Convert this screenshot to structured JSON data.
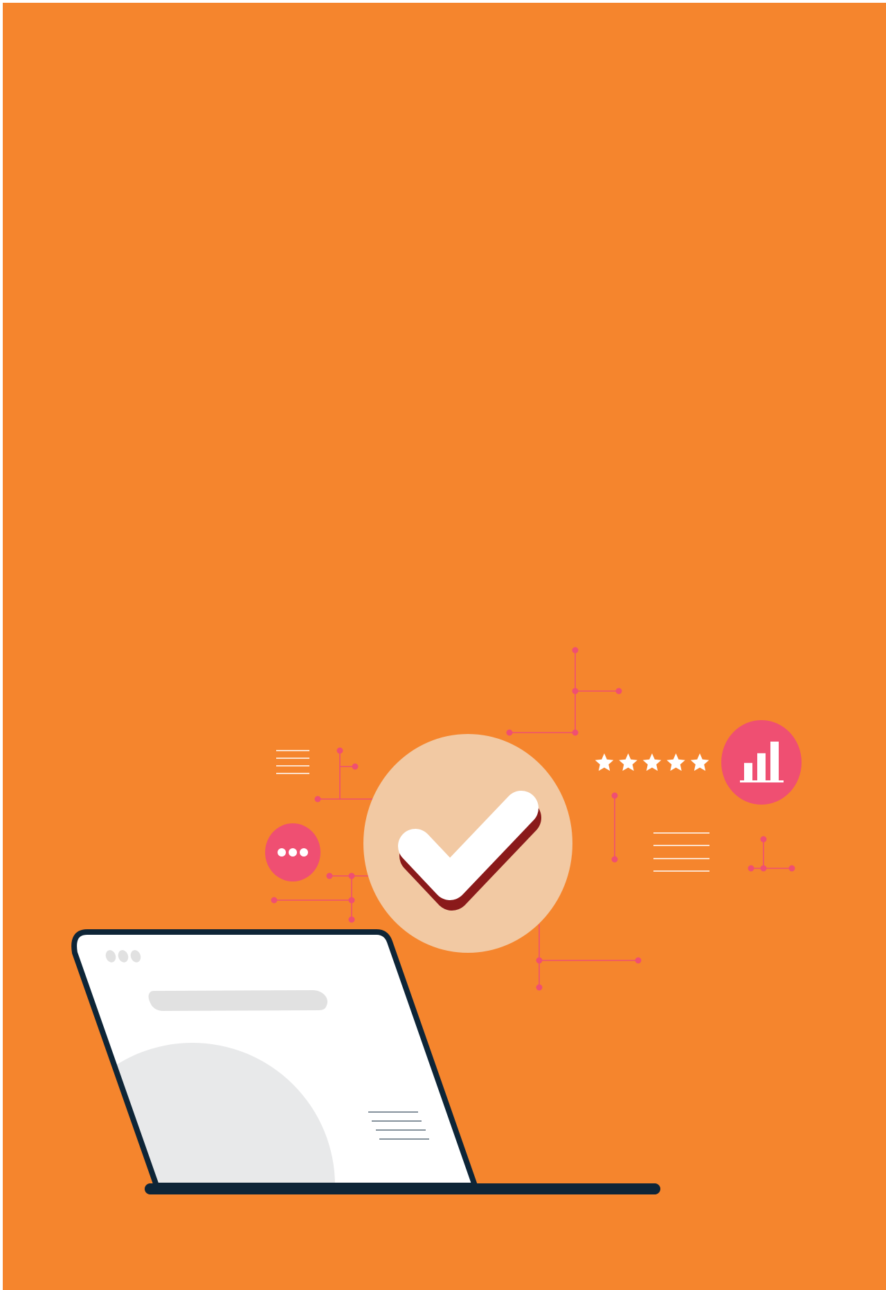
{
  "colors": {
    "background": "#F5852D",
    "accent_pink": "#EF4F72",
    "check_circle": "#F2C9A3",
    "check_shadow": "#8A1A1A",
    "laptop_outline": "#0E2537",
    "screen": "#FFFFFF",
    "screen_shape": "#E8E9EA",
    "white": "#FFFFFF"
  },
  "illustration": {
    "rating_stars": 5,
    "chart_bar_levels": [
      0.45,
      0.7,
      1.0
    ],
    "chat_dots": 3,
    "browser_dots": 3
  }
}
